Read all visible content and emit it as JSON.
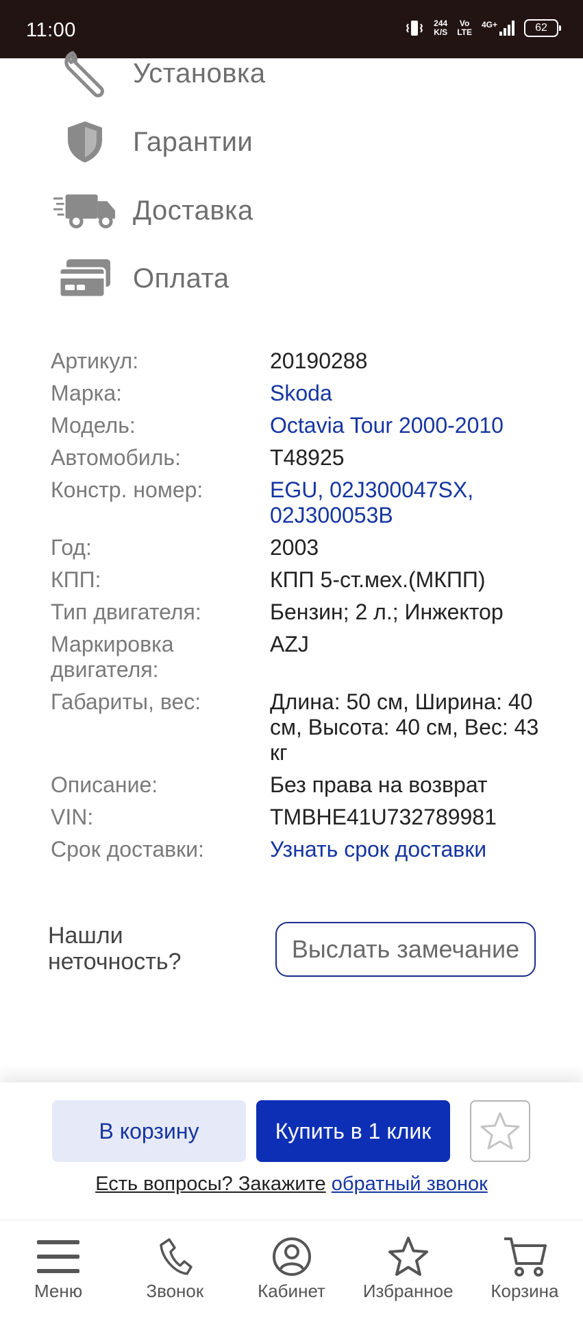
{
  "status_bar": {
    "time": "11:00",
    "speed_value": "244",
    "speed_unit": "K/S",
    "volte_top": "Vo",
    "volte_bottom": "LTE",
    "network": "4G+",
    "battery": "62"
  },
  "info_menu": [
    {
      "label": "Установка",
      "icon": "wrench-icon"
    },
    {
      "label": "Гарантии",
      "icon": "shield-icon"
    },
    {
      "label": "Доставка",
      "icon": "truck-icon"
    },
    {
      "label": "Оплата",
      "icon": "payment-card-icon"
    }
  ],
  "specs": [
    {
      "key": "Артикул:",
      "value": "20190288"
    },
    {
      "key": "Марка:",
      "value": "Skoda"
    },
    {
      "key": "Модель:",
      "value": "Octavia Tour 2000-2010"
    },
    {
      "key": "Автомобиль:",
      "value": "T48925"
    },
    {
      "key": "Констр. номер:",
      "value": "EGU, 02J300047SX, 02J300053B"
    },
    {
      "key": "Год:",
      "value": "2003"
    },
    {
      "key": "КПП:",
      "value": "КПП 5-ст.мех.(МКПП)"
    },
    {
      "key": "Тип двигателя:",
      "value": "Бензин; 2 л.; Инжектор"
    },
    {
      "key": "Маркировка двигателя:",
      "value": "AZJ"
    },
    {
      "key": "Габариты, вес:",
      "value": "Длина: 50 см, Ширина: 40 см, Высота: 40 см, Вес: 43 кг"
    },
    {
      "key": "Описание:",
      "value": "Без права на возврат"
    },
    {
      "key": "VIN:",
      "value": "TMBHE41U732789981"
    },
    {
      "key": "Срок доставки:",
      "value": "Узнать срок доставки"
    }
  ],
  "report": {
    "question": "Нашли неточность?",
    "button": "Выслать замечание"
  },
  "actions": {
    "add_to_cart": "В корзину",
    "buy_one_click": "Купить в 1 клик",
    "callback_prefix": "Есть вопросы? Закажите",
    "callback_link": "обратный звонок"
  },
  "bottom_nav": [
    {
      "label": "Меню",
      "icon": "hamburger-menu-icon"
    },
    {
      "label": "Звонок",
      "icon": "phone-icon"
    },
    {
      "label": "Кабинет",
      "icon": "user-account-icon"
    },
    {
      "label": "Избранное",
      "icon": "star-icon"
    },
    {
      "label": "Корзина",
      "icon": "cart-icon"
    }
  ],
  "colors": {
    "status_bar": "#231414",
    "link": "#1535a0",
    "primary_button": "#0d2fb5",
    "secondary_button_bg": "#e6e9f7",
    "icon_gray": "#8a8a8a"
  }
}
